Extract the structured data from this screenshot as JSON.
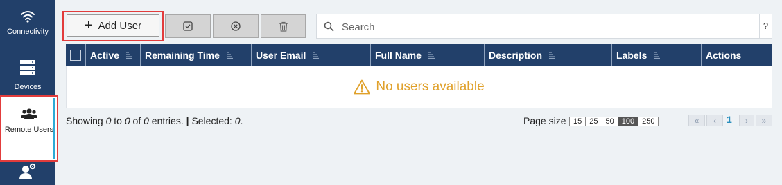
{
  "sidebar": {
    "items": [
      {
        "label": "Connectivity",
        "icon": "wifi-icon"
      },
      {
        "label": "Devices",
        "icon": "server-icon"
      },
      {
        "label": "Remote Users",
        "icon": "users-icon",
        "active": true
      },
      {
        "label": "",
        "icon": "user-gear-icon"
      }
    ]
  },
  "toolbar": {
    "add_user_label": "Add User",
    "enable_icon": "checkbox-check-icon",
    "disable_icon": "circle-x-icon",
    "delete_icon": "trash-icon"
  },
  "search": {
    "placeholder": "Search",
    "value": "",
    "help_label": "?"
  },
  "table": {
    "columns": [
      "Active",
      "Remaining Time",
      "User Email",
      "Full Name",
      "Description",
      "Labels",
      "Actions"
    ],
    "empty_message": "No users available"
  },
  "footer": {
    "showing_prefix": "Showing ",
    "showing_from": "0",
    "showing_to_word": " to ",
    "showing_to": "0",
    "showing_of_word": " of ",
    "showing_total": "0",
    "showing_suffix": " entries.",
    "separator": "|",
    "selected_label": "Selected: ",
    "selected_value": "0",
    "selected_end": ".",
    "page_size_label": "Page size",
    "page_sizes": [
      "15",
      "25",
      "50",
      "100",
      "250"
    ],
    "page_size_selected": "100",
    "current_page": "1"
  },
  "colors": {
    "sidebar_bg": "#22406a",
    "header_bg": "#22406a",
    "highlight": "#e23c3c",
    "warning": "#e0a12b",
    "active_accent": "#2ea9d6"
  }
}
